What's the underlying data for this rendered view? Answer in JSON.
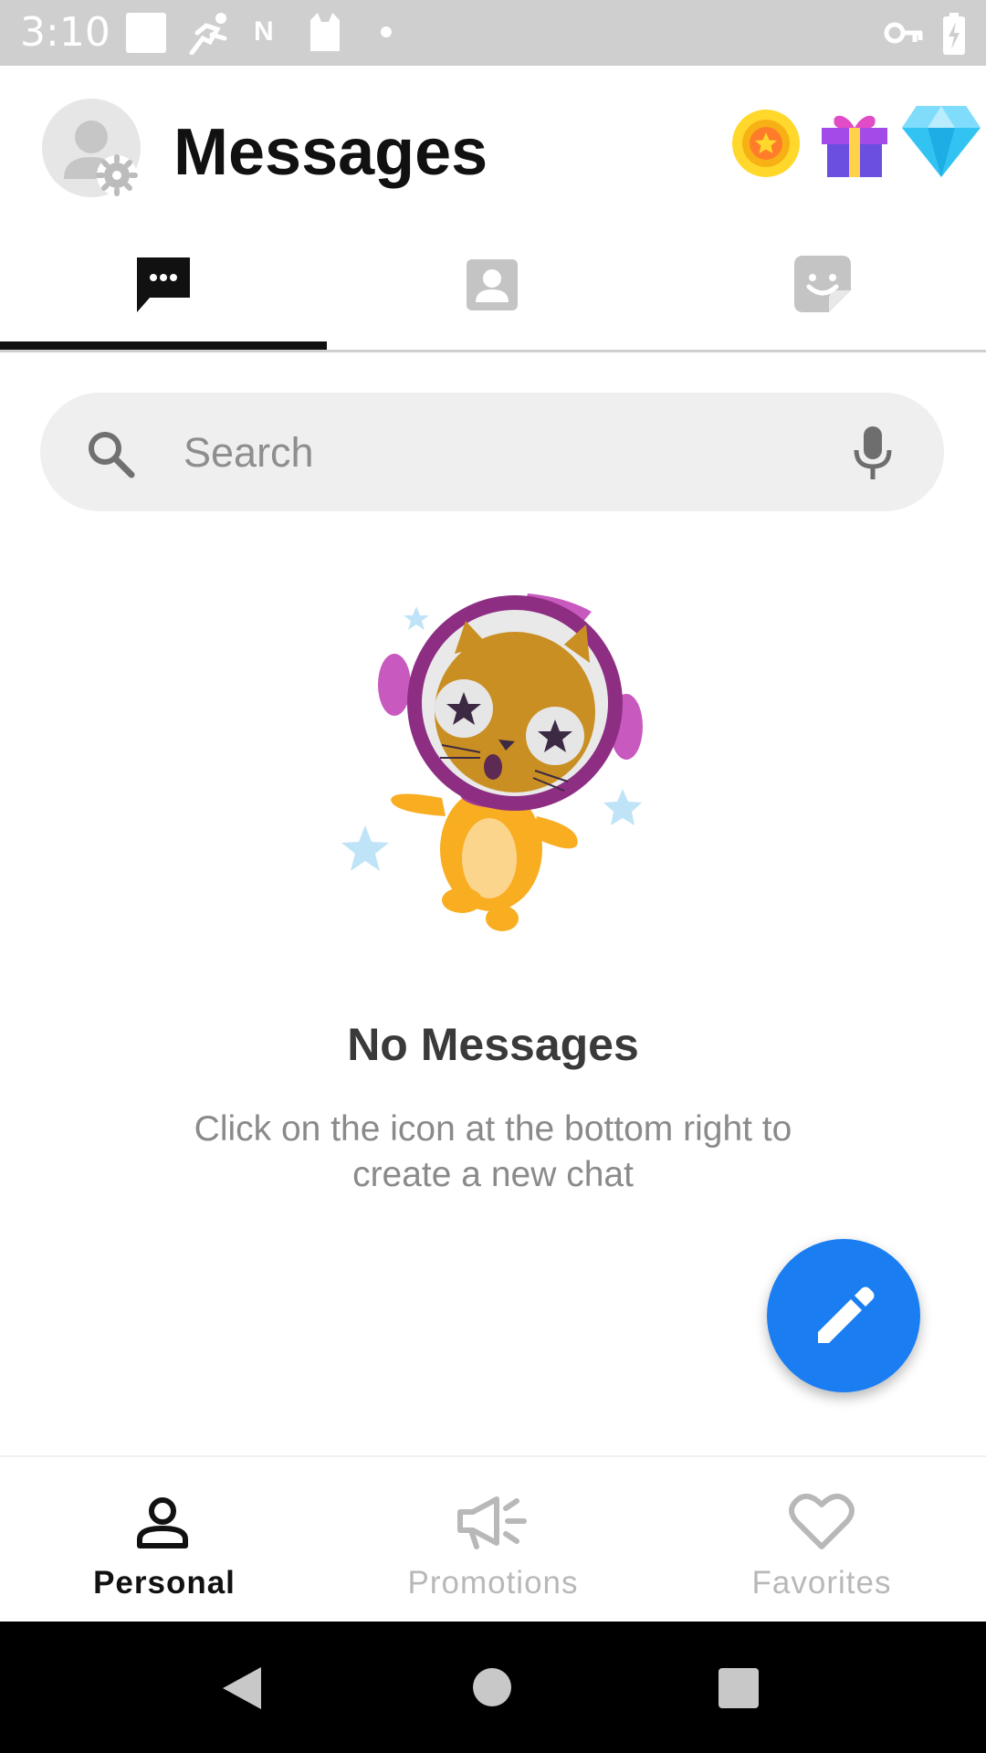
{
  "status_bar": {
    "time": "3:10",
    "icons": [
      "square-icon",
      "runner-icon",
      "n-icon",
      "cat-icon",
      "dot-icon",
      "vpn-key-icon",
      "battery-charging-icon"
    ]
  },
  "header": {
    "title": "Messages",
    "icons": [
      "avatar-settings-icon",
      "coin-icon",
      "gift-icon",
      "diamond-icon"
    ]
  },
  "tabs": [
    {
      "name": "chats",
      "icon": "chat-bubble-icon",
      "active": true
    },
    {
      "name": "contacts",
      "icon": "contact-card-icon",
      "active": false
    },
    {
      "name": "stickers",
      "icon": "sticker-icon",
      "active": false
    }
  ],
  "search": {
    "placeholder": "Search",
    "value": ""
  },
  "empty_state": {
    "title": "No Messages",
    "subtitle": "Click on the icon at the bottom right to create a new chat"
  },
  "fab": {
    "icon": "pencil-icon"
  },
  "bottom_nav": {
    "items": [
      {
        "label": "Personal",
        "icon": "person-icon",
        "active": true
      },
      {
        "label": "Promotions",
        "icon": "megaphone-icon",
        "active": false
      },
      {
        "label": "Favorites",
        "icon": "heart-icon",
        "active": false
      }
    ]
  },
  "colors": {
    "accent": "#1a7ef2",
    "active": "#111111",
    "inactive": "#b8b8b8",
    "status_bar": "#cfcfcf"
  }
}
